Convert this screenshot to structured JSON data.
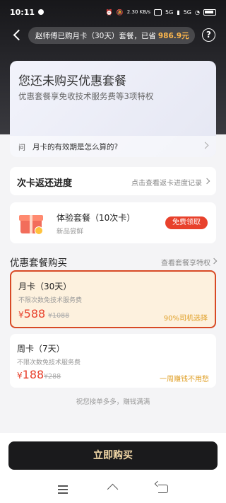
{
  "status_bar": {
    "time": "10:11",
    "speed": "2.30 KB/s",
    "network_a": "5G",
    "network_b": "5G"
  },
  "header": {
    "notice_text": "赵师傅已购月卡（30天）套餐，已省",
    "notice_amount": "986.9元",
    "help_label": "?"
  },
  "promo": {
    "title": "您还未购买优惠套餐",
    "subtitle": "优惠套餐享免收技术服务费等3项特权",
    "faq_tag": "问",
    "faq_text": "月卡的有效期是怎么算的?"
  },
  "progress": {
    "title": "次卡返还进度",
    "link": "点击查看返卡进度记录"
  },
  "trial": {
    "name": "体验套餐（10次卡）",
    "sub": "新品尝鲜",
    "button": "免费领取"
  },
  "plans_section": {
    "title": "优惠套餐购买",
    "link": "查看套餐享特权"
  },
  "plans": [
    {
      "name": "月卡（30天）",
      "desc": "不限次数免技术服务费",
      "currency": "¥",
      "price": "588",
      "old_price": "¥1088",
      "tag": "90%司机选择"
    },
    {
      "name": "周卡（7天）",
      "desc": "不限次数免技术服务费",
      "currency": "¥",
      "price": "188",
      "old_price": "¥288",
      "tag": "一周赚钱不用愁"
    }
  ],
  "footer_note": "祝您接单多多，赚钱满满",
  "buy_button": "立即购买",
  "colors": {
    "accent_red": "#e8412c",
    "gold_text": "#f3d9a8",
    "dark": "#1a1a1c"
  }
}
